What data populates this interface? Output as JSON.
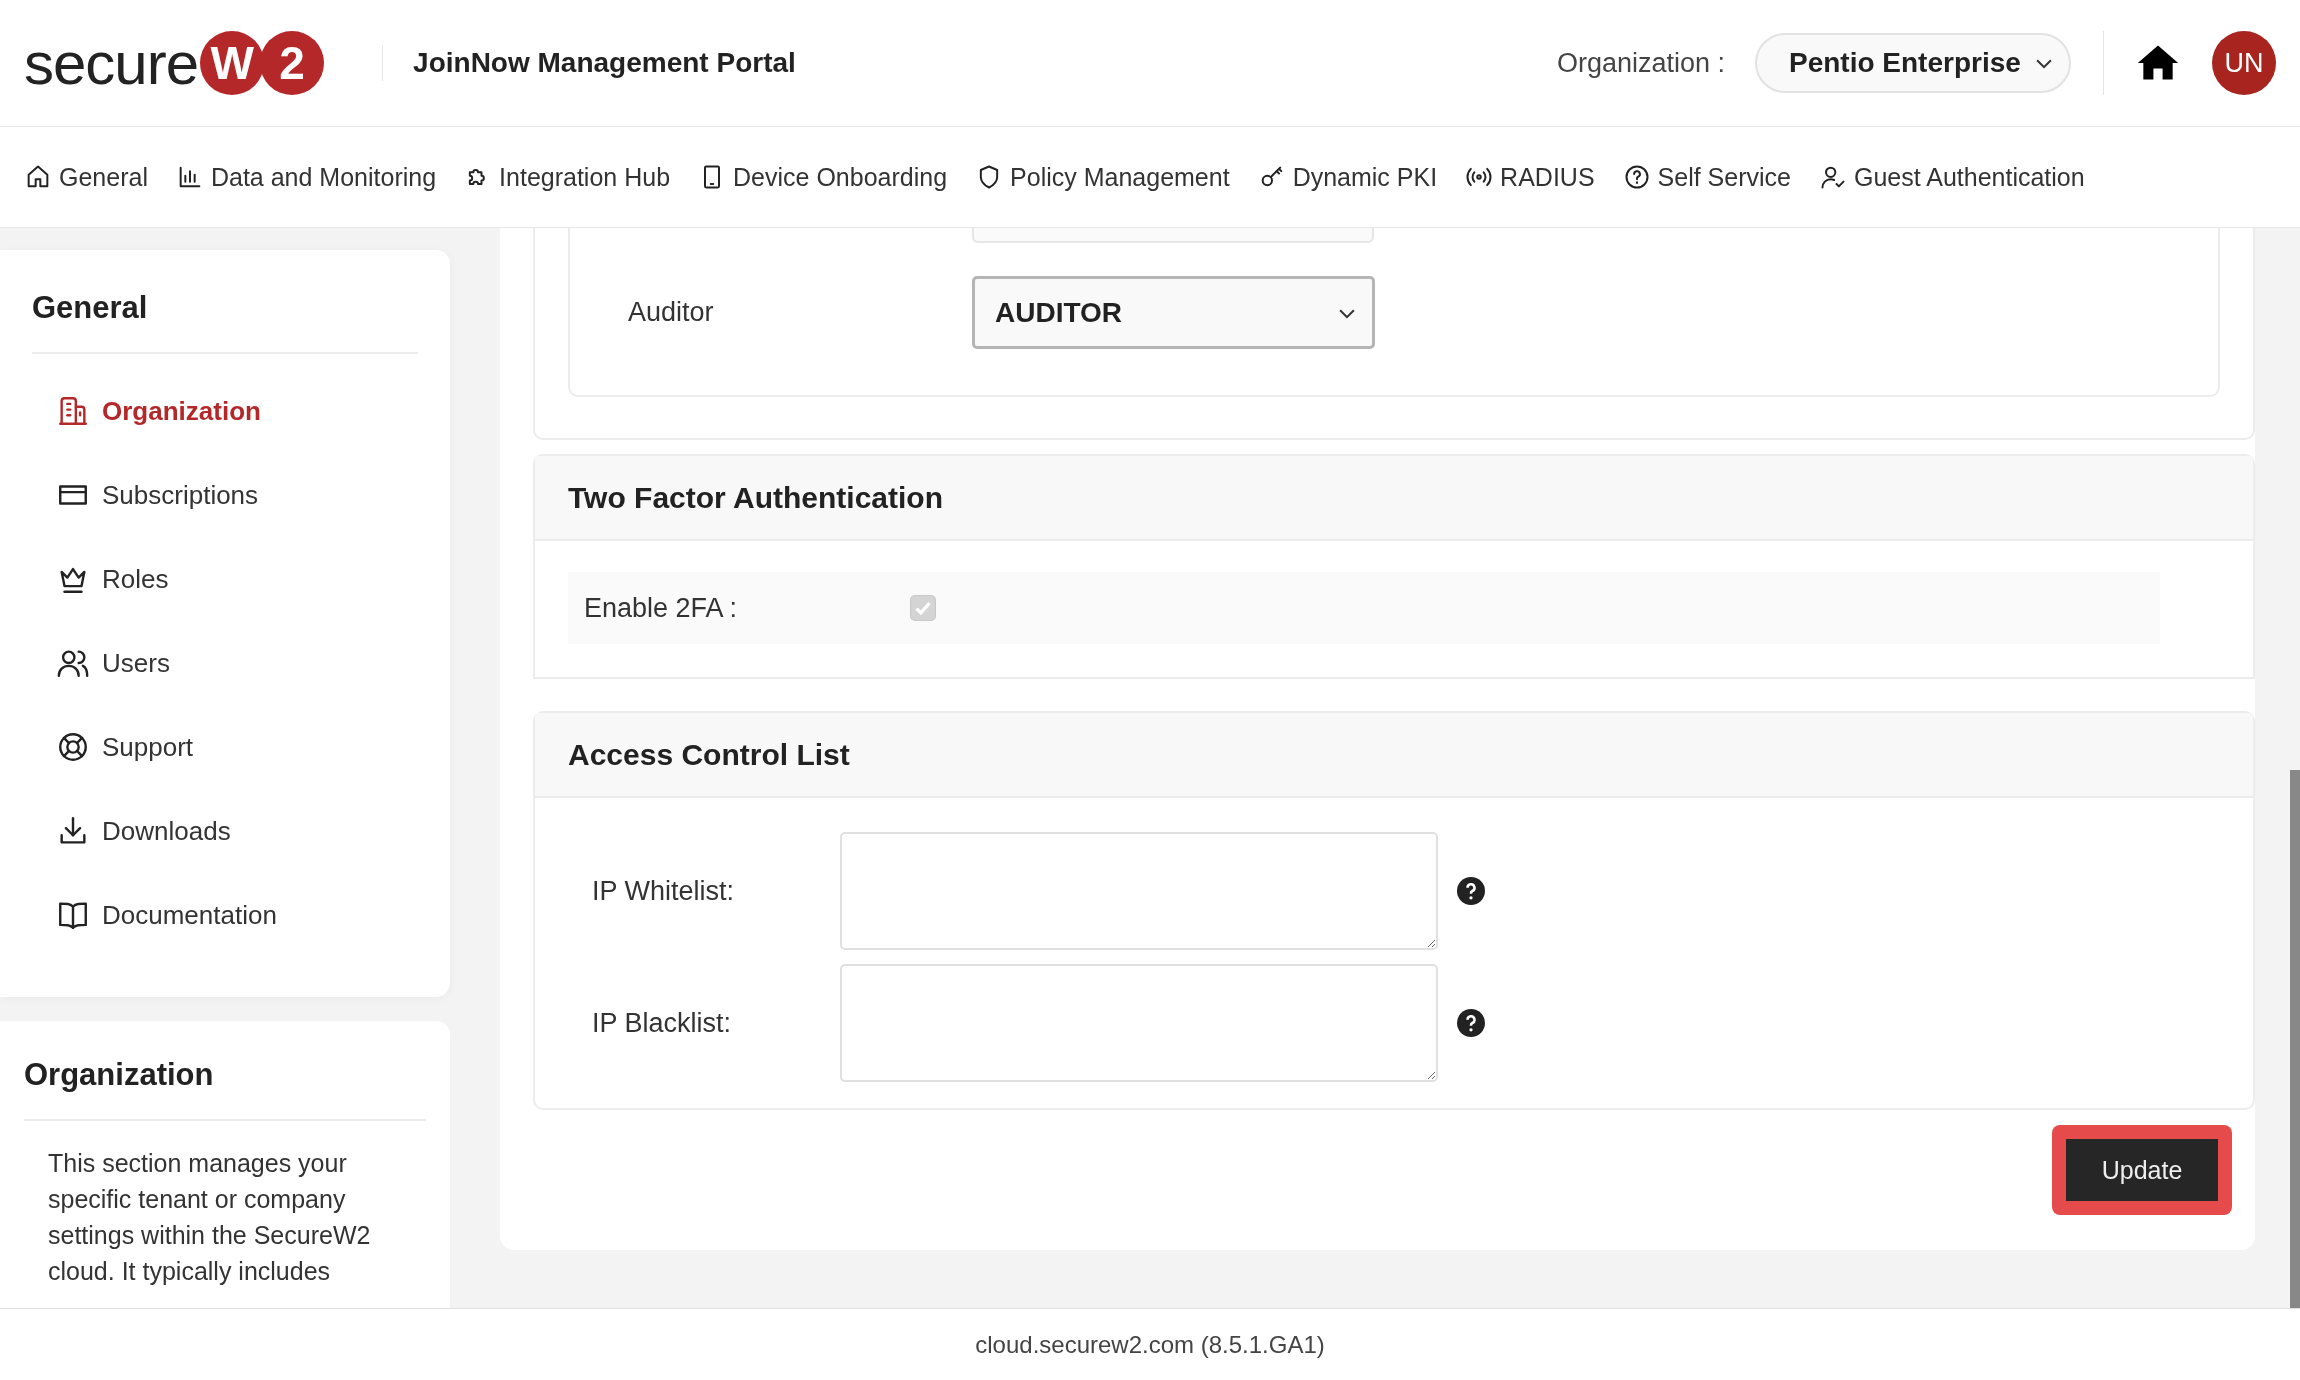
{
  "header": {
    "logo": {
      "word": "secure",
      "badge_letters": [
        "W",
        "2"
      ]
    },
    "title": "JoinNow Management Portal",
    "organization_label": "Organization :",
    "organization_value": "Pentio Enterprise",
    "avatar_initials": "UN"
  },
  "nav": [
    {
      "label": "General"
    },
    {
      "label": "Data and Monitoring"
    },
    {
      "label": "Integration Hub"
    },
    {
      "label": "Device Onboarding"
    },
    {
      "label": "Policy Management"
    },
    {
      "label": "Dynamic PKI"
    },
    {
      "label": "RADIUS"
    },
    {
      "label": "Self Service"
    },
    {
      "label": "Guest Authentication"
    }
  ],
  "sidebar": {
    "title": "General",
    "items": [
      {
        "label": "Organization",
        "selected": true
      },
      {
        "label": "Subscriptions",
        "selected": false
      },
      {
        "label": "Roles",
        "selected": false
      },
      {
        "label": "Users",
        "selected": false
      },
      {
        "label": "Support",
        "selected": false
      },
      {
        "label": "Downloads",
        "selected": false
      },
      {
        "label": "Documentation",
        "selected": false
      }
    ]
  },
  "info_card": {
    "title": "Organization",
    "text": "This section manages your specific tenant or company settings within the SecureW2 cloud. It typically includes"
  },
  "roles_section": {
    "rows": [
      {
        "label": "Auditor",
        "value": "AUDITOR"
      }
    ]
  },
  "two_factor": {
    "title": "Two Factor Authentication",
    "label": "Enable 2FA :",
    "checked": true,
    "disabled": true
  },
  "access_control": {
    "title": "Access Control List",
    "fields": [
      {
        "label": "IP Whitelist:"
      },
      {
        "label": "IP Blacklist:"
      }
    ]
  },
  "update_button": {
    "label": "Update",
    "highlighted": true
  },
  "footer": "cloud.securew2.com (8.5.1.GA1)"
}
